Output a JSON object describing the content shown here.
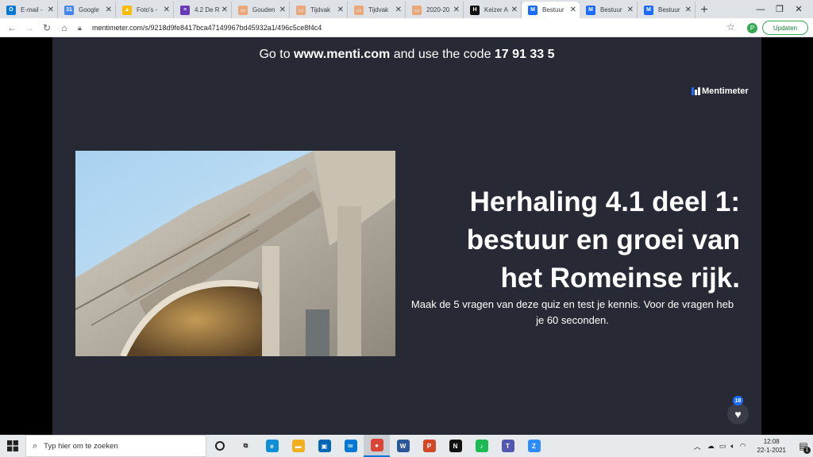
{
  "browser": {
    "tabs": [
      {
        "title": "E-mail -",
        "favicon": "outlook-icon",
        "color": "#0078d4",
        "glyph": "O"
      },
      {
        "title": "Google",
        "favicon": "google-calendar-icon",
        "color": "#4285f4",
        "glyph": "31"
      },
      {
        "title": "Foto's -",
        "favicon": "google-drive-icon",
        "color": "#fbbc04",
        "glyph": "▲"
      },
      {
        "title": "4.2 De R",
        "favicon": "forms-icon",
        "color": "#673ab7",
        "glyph": "≡"
      },
      {
        "title": "Gouden",
        "favicon": "document-icon",
        "color": "#e8a87c",
        "glyph": "▭"
      },
      {
        "title": "Tijdvak",
        "favicon": "document-icon",
        "color": "#e8a87c",
        "glyph": "▭"
      },
      {
        "title": "Tijdvak",
        "favicon": "document-icon",
        "color": "#e8a87c",
        "glyph": "▭"
      },
      {
        "title": "2020-20",
        "favicon": "document-icon",
        "color": "#e8a87c",
        "glyph": "▭"
      },
      {
        "title": "Keizer A",
        "favicon": "h-icon",
        "color": "#111111",
        "glyph": "H"
      },
      {
        "title": "Bestuur",
        "favicon": "mentimeter-icon",
        "color": "#196cff",
        "glyph": "M",
        "active": true
      },
      {
        "title": "Bestuur",
        "favicon": "mentimeter-icon",
        "color": "#196cff",
        "glyph": "M"
      },
      {
        "title": "Bestuur",
        "favicon": "mentimeter-icon",
        "color": "#196cff",
        "glyph": "M"
      }
    ],
    "url": "mentimeter.com/s/9218d9fe8417bca47149967bd45932a1/496c5ce8f4c4",
    "profile_initial": "P",
    "update_label": "Updaten"
  },
  "slide": {
    "join_prefix": "Go to ",
    "join_site": "www.menti.com",
    "join_middle": " and use the code ",
    "join_code": "17 91 33 5",
    "brand": "Mentimeter",
    "title_lines": [
      "Herhaling 4.1 deel 1:",
      "bestuur en groei van",
      "het Romeinse rijk."
    ],
    "subtitle": "Maak de 5 vragen van deze quiz en test je kennis. Voor de vragen heb je 60 seconden.",
    "likes": "18"
  },
  "taskbar": {
    "search_placeholder": "Typ hier om te zoeken",
    "apps": [
      {
        "name": "task-view-icon",
        "glyph": "⧉",
        "color": "transparent"
      },
      {
        "name": "edge-icon",
        "glyph": "e",
        "color": "#0c8ed9"
      },
      {
        "name": "file-explorer-icon",
        "glyph": "▬",
        "color": "#f2b01e"
      },
      {
        "name": "store-icon",
        "glyph": "▣",
        "color": "#0067b8"
      },
      {
        "name": "mail-icon",
        "glyph": "✉",
        "color": "#0078d4"
      },
      {
        "name": "chrome-icon",
        "glyph": "●",
        "color": "#db4437",
        "active": true
      },
      {
        "name": "word-icon",
        "glyph": "W",
        "color": "#2b579a"
      },
      {
        "name": "powerpoint-icon",
        "glyph": "P",
        "color": "#d24726"
      },
      {
        "name": "netflix-icon",
        "glyph": "N",
        "color": "#111111"
      },
      {
        "name": "spotify-icon",
        "glyph": "♪",
        "color": "#1db954"
      },
      {
        "name": "teams-icon",
        "glyph": "T",
        "color": "#5558af"
      },
      {
        "name": "zoom-icon",
        "glyph": "Z",
        "color": "#2d8cff"
      }
    ],
    "time": "12:08",
    "date": "22-1-2021",
    "notifications": "1"
  }
}
